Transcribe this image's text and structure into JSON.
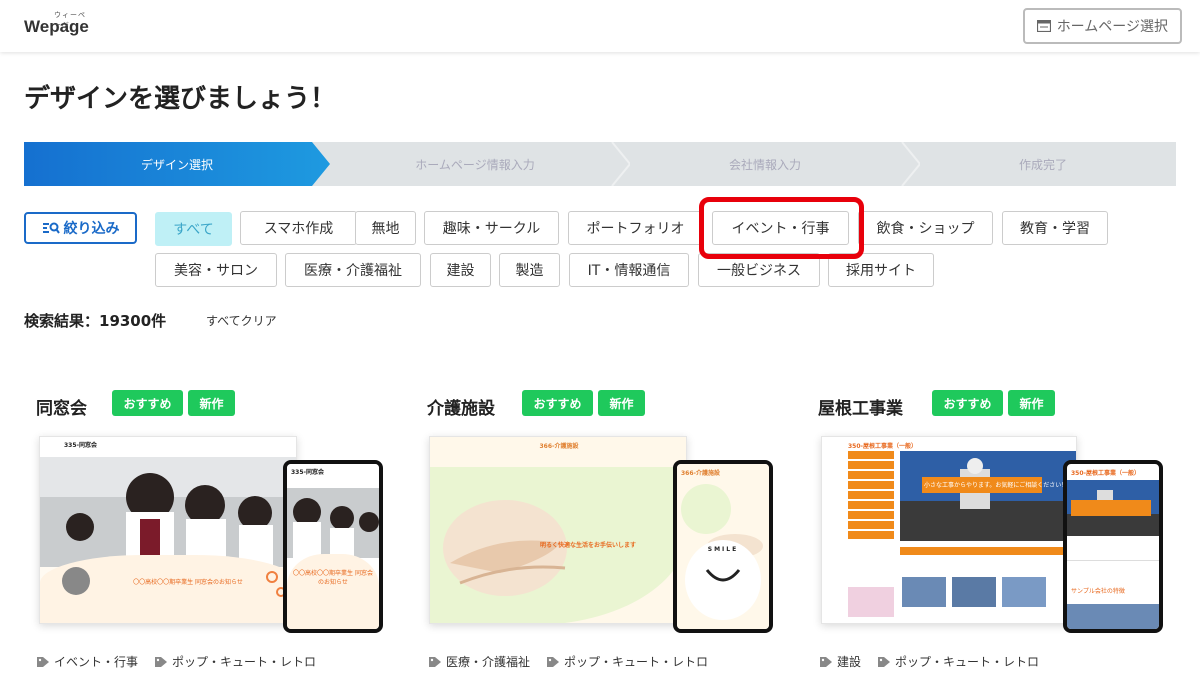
{
  "header": {
    "logo_ruby": "ウィーページ",
    "logo": "Wepage",
    "hp_select_label": "ホームページ選択"
  },
  "title": "デザインを選びましょう！",
  "steps": [
    "デザイン選択",
    "ホームページ情報入力",
    "会社情報入力",
    "作成完了"
  ],
  "filter_button": "絞り込み",
  "tags": [
    "すべて",
    "スマホ作成",
    "無地",
    "趣味・サークル",
    "ポートフォリオ",
    "イベント・行事",
    "飲食・ショップ",
    "教育・学習",
    "美容・サロン",
    "医療・介護福祉",
    "建設",
    "製造",
    "IT・情報通信",
    "一般ビジネス",
    "採用サイト"
  ],
  "result_text": "検索結果：19300件",
  "clear_all": "すべてクリア",
  "badges": {
    "recommend": "おすすめ",
    "new": "新作"
  },
  "cards": [
    {
      "title": "同窓会",
      "site_title": "335-同窓会",
      "headline": "〇〇高校〇〇期卒業生 同窓会のお知らせ",
      "tags": [
        "イベント・行事",
        "ポップ・キュート・レトロ"
      ]
    },
    {
      "title": "介護施設",
      "site_title": "366-介護施設",
      "headline": "明るく快適な生活をお手伝いします",
      "smile": "SMILE",
      "tags": [
        "医療・介護福祉",
        "ポップ・キュート・レトロ"
      ]
    },
    {
      "title": "屋根工事業",
      "site_title": "350-屋根工事業（一般）",
      "headline": "小さな工事からやります。お気軽にご相談ください！",
      "sample": "サンプル会社の特徴",
      "tags": [
        "建設",
        "ポップ・キュート・レトロ"
      ]
    }
  ],
  "colors": {
    "accent": "#1a6ac8",
    "badge": "#1fc95c",
    "active_tag_bg": "#bff0f6",
    "highlight": "#e8000b",
    "step_active": "#1a7fd6"
  }
}
